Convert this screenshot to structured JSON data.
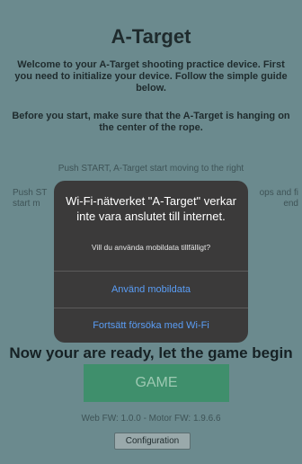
{
  "page": {
    "title": "A-Target",
    "intro": "Welcome to your A-Target shooting practice device. First you need to initialize your device. Follow the simple guide below.",
    "before_start": "Before you start, make sure that the A-Target is hanging on the center of the rope.",
    "step1": "Push START, A-Target start moving to the right",
    "step2_left": "Push ST start m",
    "step2_right": "ops and fi end",
    "ready": "Now your are ready, let the game begin",
    "game_button": "GAME",
    "firmware": "Web FW: 1.0.0 - Motor FW: 1.9.6.6",
    "config_button": "Configuration"
  },
  "dialog": {
    "title": "Wi-Fi-nätverket \"A-Target\" verkar inte vara anslutet till internet.",
    "message": "Vill du använda mobildata tillfälligt?",
    "use_mobile_data": "Använd mobildata",
    "keep_wifi": "Fortsätt försöka med Wi-Fi"
  },
  "colors": {
    "background": "#6b8a8e",
    "game_button": "#3f8f6c",
    "dialog_bg": "#3b3a3a",
    "dialog_action": "#5a9df5"
  }
}
